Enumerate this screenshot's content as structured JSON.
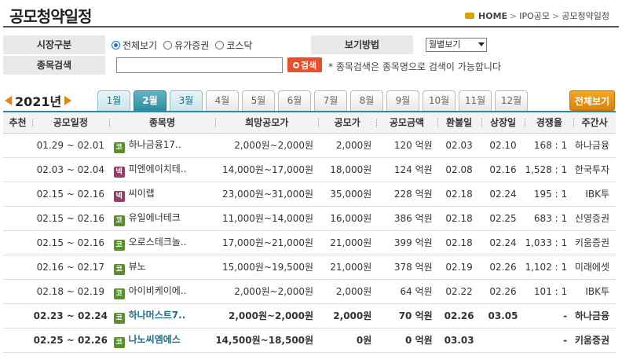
{
  "header": {
    "title": "공모청약일정",
    "breadcrumb": {
      "home": "HOME",
      "level1": "IPO공모",
      "level2": "공모청약일정",
      "sep": ">"
    }
  },
  "search": {
    "market_label": "시장구분",
    "market_options": [
      {
        "label": "전체보기",
        "selected": true
      },
      {
        "label": "유가증권",
        "selected": false
      },
      {
        "label": "코스닥",
        "selected": false
      }
    ],
    "view_label": "보기방법",
    "view_selected": "월별보기",
    "stock_label": "종목검색",
    "input_value": "",
    "button_label": "검색",
    "hint": "* 종목검색은 종목명으로 검색이 가능합니다"
  },
  "months": {
    "year": "2021년",
    "tabs": [
      {
        "label": "1월",
        "state": "avail"
      },
      {
        "label": "2월",
        "state": "active"
      },
      {
        "label": "3월",
        "state": "avail"
      },
      {
        "label": "4월",
        "state": "normal"
      },
      {
        "label": "5월",
        "state": "normal"
      },
      {
        "label": "6월",
        "state": "normal"
      },
      {
        "label": "7월",
        "state": "normal"
      },
      {
        "label": "8월",
        "state": "normal"
      },
      {
        "label": "9월",
        "state": "normal"
      },
      {
        "label": "10월",
        "state": "normal"
      },
      {
        "label": "11월",
        "state": "normal"
      },
      {
        "label": "12월",
        "state": "normal"
      }
    ],
    "all_button": "전체보기"
  },
  "table": {
    "columns": [
      "추천",
      "공모일정",
      "종목명",
      "희망공모가",
      "공모가",
      "공모금액",
      "환불일",
      "상장일",
      "경쟁율",
      "주간사"
    ],
    "rows": [
      {
        "rec": "",
        "period": "01.29 ~ 02.01",
        "badge": "코",
        "badge_type": "k",
        "name": "하나금융17..",
        "hope": "2,000원~2,000원",
        "price": "2,000원",
        "amount": "120 억원",
        "refund": "02.03",
        "listing": "02.10",
        "compete": "168 : 1",
        "manager": "하나금융",
        "bold": false
      },
      {
        "rec": "",
        "period": "02.03 ~ 02.04",
        "badge": "넥",
        "badge_type": "n",
        "name": "피엔에이치테..",
        "hope": "14,000원~17,000원",
        "price": "18,000원",
        "amount": "124 억원",
        "refund": "02.08",
        "listing": "02.16",
        "compete": "1,528 : 1",
        "manager": "한국투자",
        "bold": false
      },
      {
        "rec": "",
        "period": "02.15 ~ 02.16",
        "badge": "넥",
        "badge_type": "n",
        "name": "씨이랩",
        "hope": "23,000원~31,000원",
        "price": "35,000원",
        "amount": "228 억원",
        "refund": "02.18",
        "listing": "02.24",
        "compete": "195 : 1",
        "manager": "IBK투",
        "bold": false
      },
      {
        "rec": "",
        "period": "02.15 ~ 02.16",
        "badge": "코",
        "badge_type": "k",
        "name": "유일에너테크",
        "hope": "11,000원~14,000원",
        "price": "16,000원",
        "amount": "386 억원",
        "refund": "02.18",
        "listing": "02.25",
        "compete": "683 : 1",
        "manager": "신영증권",
        "bold": false
      },
      {
        "rec": "",
        "period": "02.15 ~ 02.16",
        "badge": "코",
        "badge_type": "k",
        "name": "오로스테크놀..",
        "hope": "17,000원~21,000원",
        "price": "21,000원",
        "amount": "399 억원",
        "refund": "02.18",
        "listing": "02.24",
        "compete": "1,033 : 1",
        "manager": "키움증권",
        "bold": false
      },
      {
        "rec": "",
        "period": "02.16 ~ 02.17",
        "badge": "코",
        "badge_type": "k",
        "name": "뷰노",
        "hope": "15,000원~19,500원",
        "price": "21,000원",
        "amount": "378 억원",
        "refund": "02.19",
        "listing": "02.26",
        "compete": "1,102 : 1",
        "manager": "미래에셋",
        "bold": false
      },
      {
        "rec": "",
        "period": "02.18 ~ 02.19",
        "badge": "코",
        "badge_type": "k",
        "name": "아이비케이에..",
        "hope": "2,000원~2,000원",
        "price": "2,000원",
        "amount": "64 억원",
        "refund": "02.22",
        "listing": "02.26",
        "compete": "101 : 1",
        "manager": "IBK투",
        "bold": false
      },
      {
        "rec": "",
        "period": "02.23 ~ 02.24",
        "badge": "코",
        "badge_type": "k",
        "name": "하나머스트7..",
        "hope": "2,000원~2,000원",
        "price": "2,000원",
        "amount": "70 억원",
        "refund": "02.26",
        "listing": "03.05",
        "compete": "-",
        "manager": "하나금융",
        "bold": true
      },
      {
        "rec": "",
        "period": "02.25 ~ 02.26",
        "badge": "코",
        "badge_type": "k",
        "name": "나노씨엠에스",
        "hope": "14,500원~18,500원",
        "price": "0원",
        "amount": "0 억원",
        "refund": "03.03",
        "listing": "",
        "compete": "-",
        "manager": "키움증권",
        "bold": true
      }
    ]
  }
}
